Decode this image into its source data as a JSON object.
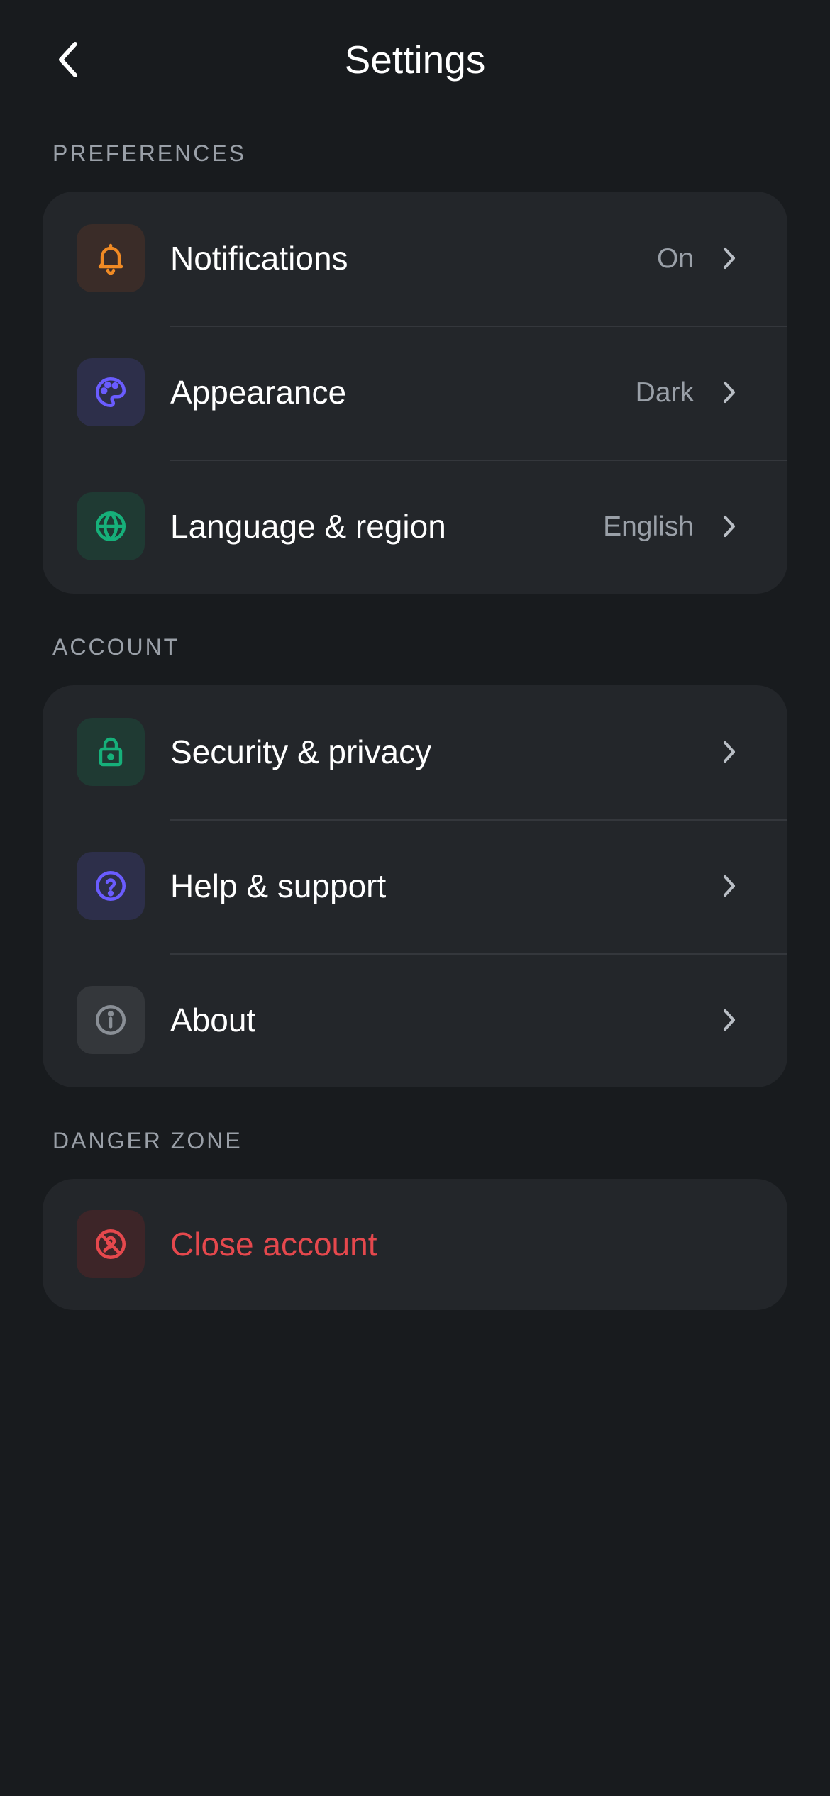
{
  "header": {
    "title": "Settings",
    "back_icon": "chevron-left-icon"
  },
  "sections": [
    {
      "label": "PREFERENCES",
      "items": [
        {
          "label": "Notifications",
          "value": "On",
          "icon": "bell-icon",
          "icon_color": "#f08a24",
          "tile_color": "#3a2c28"
        },
        {
          "label": "Appearance",
          "value": "Dark",
          "icon": "palette-icon",
          "icon_color": "#6a5cff",
          "tile_color": "#2d2f4a"
        },
        {
          "label": "Language & region",
          "value": "English",
          "icon": "globe-icon",
          "icon_color": "#16b07a",
          "tile_color": "#1f3a33"
        }
      ]
    },
    {
      "label": "ACCOUNT",
      "items": [
        {
          "label": "Security & privacy",
          "value": "",
          "icon": "lock-icon",
          "icon_color": "#16b07a",
          "tile_color": "#1f3a33"
        },
        {
          "label": "Help & support",
          "value": "",
          "icon": "help-circle-icon",
          "icon_color": "#6a5cff",
          "tile_color": "#2d2f4a"
        },
        {
          "label": "About",
          "value": "",
          "icon": "info-icon",
          "icon_color": "#8a8f96",
          "tile_color": "#34373b"
        }
      ]
    },
    {
      "label": "DANGER ZONE",
      "items": [
        {
          "label": "Close account",
          "value": "",
          "icon": "close-account-icon",
          "icon_color": "#e5484d",
          "tile_color": "#3d2528"
        }
      ]
    }
  ],
  "colors": {
    "background": "#181b1e",
    "card": "#23262a",
    "secondary_text": "#9aa0a8",
    "danger": "#e5484d"
  }
}
